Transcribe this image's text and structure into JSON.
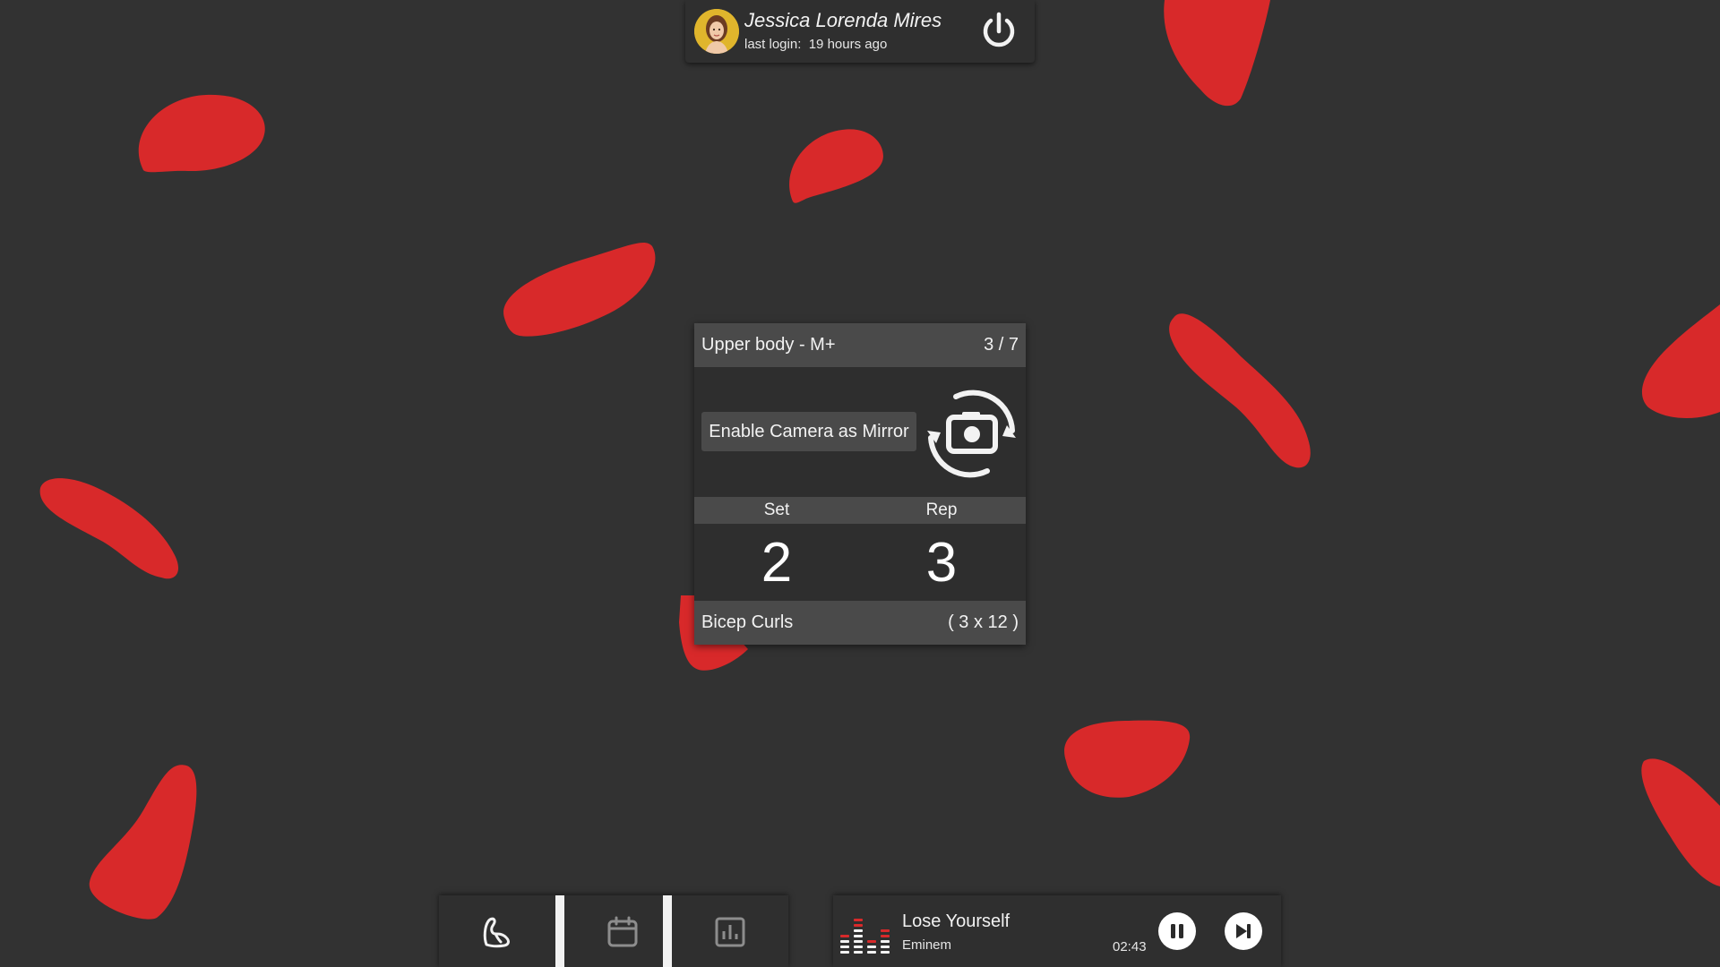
{
  "theme": {
    "background": "#323232",
    "accent": "#d8292a",
    "panel": "#2f2f2f",
    "panel_header": "#4a4a4a"
  },
  "user": {
    "name": "Jessica Lorenda Mires",
    "last_login_label": "last login:",
    "last_login_value": "19 hours ago",
    "avatar_icon": "user-avatar",
    "power_icon": "power-icon"
  },
  "workout": {
    "title": "Upper body - M+",
    "progress": "3 / 7",
    "mirror_button_label": "Enable Camera as Mirror",
    "camera_icon": "camera-switch-icon",
    "set_label": "Set",
    "rep_label": "Rep",
    "set_value": "2",
    "rep_value": "3",
    "exercise_name": "Bicep Curls",
    "exercise_scheme": "( 3 x 12 )"
  },
  "nav": {
    "tabs": [
      {
        "id": "workout",
        "icon": "flexed-arm-icon",
        "active": true
      },
      {
        "id": "calendar",
        "icon": "calendar-icon",
        "active": false
      },
      {
        "id": "stats",
        "icon": "bar-chart-icon",
        "active": false
      }
    ]
  },
  "player": {
    "title": "Lose Yourself",
    "artist": "Eminem",
    "time": "02:43",
    "eq_icon": "equalizer-icon",
    "pause_icon": "pause-icon",
    "next_icon": "skip-next-icon"
  }
}
